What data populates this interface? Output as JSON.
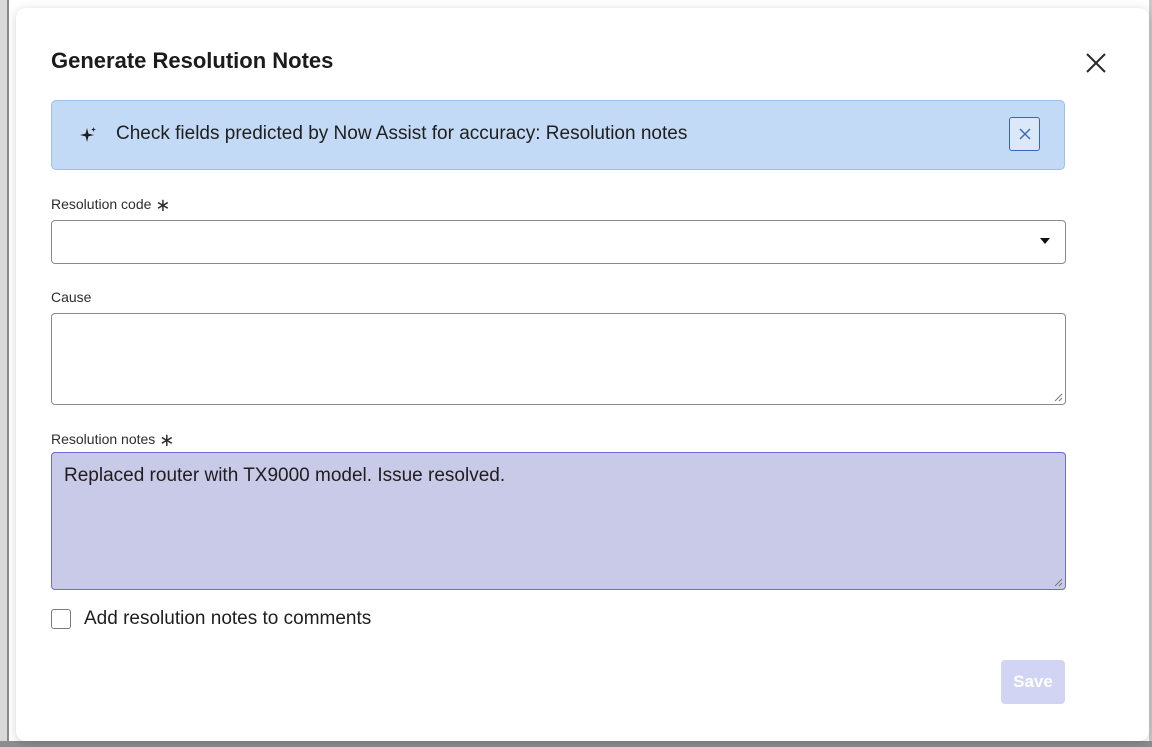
{
  "dialog": {
    "title": "Generate Resolution Notes",
    "close_icon": "close-icon"
  },
  "banner": {
    "icon": "sparkle-icon",
    "text": "Check fields predicted by Now Assist for accuracy: Resolution notes",
    "dismiss_icon": "close-icon",
    "background_color": "#c3daf6"
  },
  "fields": {
    "resolution_code": {
      "label": "Resolution code",
      "required_marker": "∗",
      "value": "",
      "dropdown_icon": "caret-down-icon"
    },
    "cause": {
      "label": "Cause",
      "value": ""
    },
    "resolution_notes": {
      "label": "Resolution notes",
      "required_marker": "∗",
      "value": "Replaced router with TX9000 model. Issue resolved.",
      "background_color": "#c9c9e8"
    }
  },
  "checkbox": {
    "label": "Add resolution notes to comments",
    "checked": false
  },
  "actions": {
    "save_label": "Save",
    "save_enabled": false
  },
  "colors": {
    "accent": "#3b63c4",
    "save_disabled": "#d2d4f3"
  }
}
